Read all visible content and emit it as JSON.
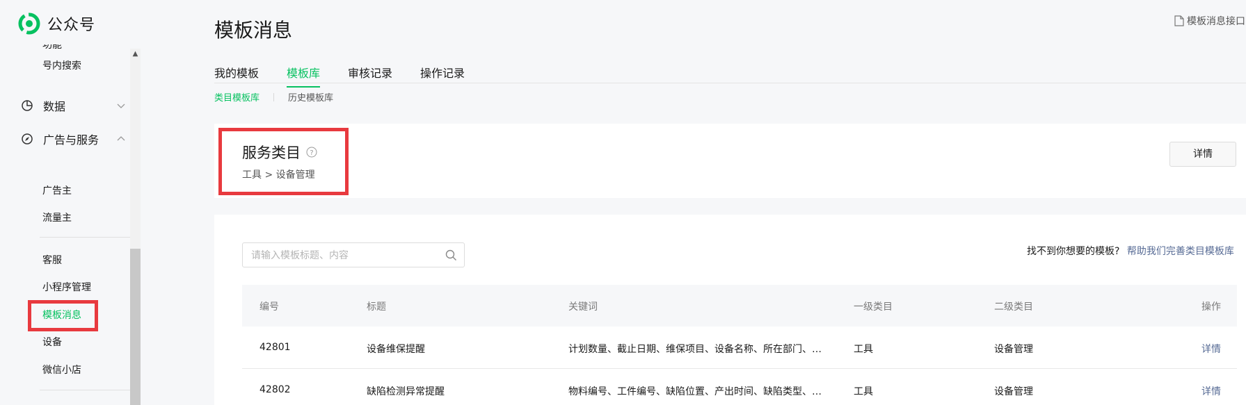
{
  "app": {
    "name": "公众号",
    "brand_color": "#07c160"
  },
  "sidebar": {
    "clipped_item": "功能",
    "items_top": [
      {
        "label": "号内搜索"
      }
    ],
    "groups": [
      {
        "label": "数据",
        "icon": "pie-chart-icon",
        "expanded": false
      },
      {
        "label": "广告与服务",
        "icon": "compass-icon",
        "expanded": true
      }
    ],
    "ad_items": [
      {
        "label": "广告主"
      },
      {
        "label": "流量主"
      }
    ],
    "service_items": [
      {
        "label": "客服"
      },
      {
        "label": "小程序管理"
      },
      {
        "label": "模板消息",
        "active": true
      },
      {
        "label": "设备"
      },
      {
        "label": "微信小店"
      }
    ]
  },
  "page": {
    "title": "模板消息",
    "doc_link": "模板消息接口",
    "tabs": [
      {
        "label": "我的模板",
        "active": false
      },
      {
        "label": "模板库",
        "active": true
      },
      {
        "label": "审核记录",
        "active": false
      },
      {
        "label": "操作记录",
        "active": false
      }
    ],
    "subtabs": [
      {
        "label": "类目模板库",
        "active": true
      },
      {
        "label": "历史模板库",
        "active": false
      }
    ]
  },
  "service": {
    "title": "服务类目",
    "path": "工具 > 设备管理",
    "detail_button": "详情"
  },
  "search": {
    "placeholder": "请输入模板标题、内容",
    "value": ""
  },
  "help": {
    "text": "找不到你想要的模板?",
    "link": "帮助我们完善类目模板库"
  },
  "table": {
    "headers": {
      "id": "编号",
      "title": "标题",
      "keywords": "关键词",
      "cat1": "一级类目",
      "cat2": "二级类目",
      "action": "操作"
    },
    "rows": [
      {
        "id": "42801",
        "title": "设备维保提醒",
        "keywords": "计划数量、截止日期、维保项目、设备名称、所在部门、维保人员",
        "cat1": "工具",
        "cat2": "设备管理",
        "action": "详情"
      },
      {
        "id": "42802",
        "title": "缺陷检测异常提醒",
        "keywords": "物料编号、工件编号、缺陷位置、产出时间、缺陷类型、检测结果",
        "cat1": "工具",
        "cat2": "设备管理",
        "action": "详情"
      }
    ]
  },
  "colors": {
    "highlight": "#e83a3f",
    "link": "#576b95"
  }
}
